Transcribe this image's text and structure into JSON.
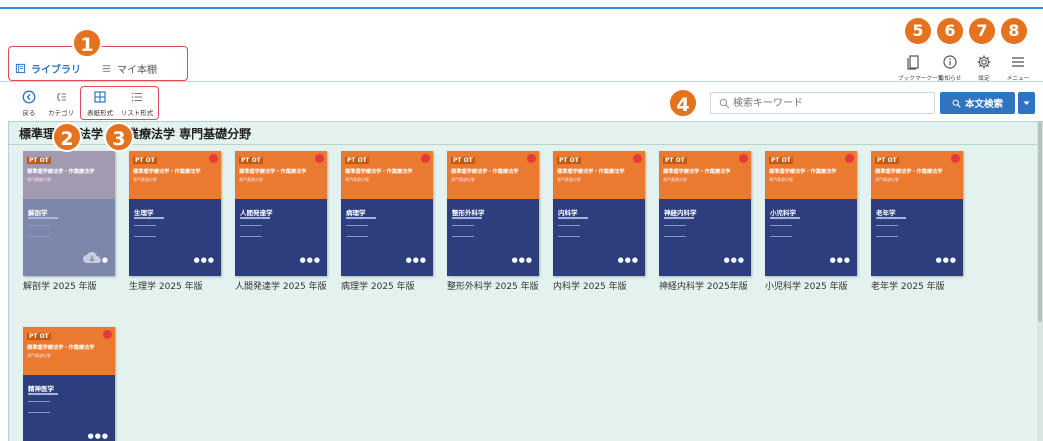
{
  "header": {
    "items": [
      {
        "num": "5",
        "label": "ブックマーク一覧",
        "icon": "bookmark-list-icon"
      },
      {
        "num": "6",
        "label": "お知らせ",
        "icon": "info-icon"
      },
      {
        "num": "7",
        "label": "設定",
        "icon": "gear-icon"
      },
      {
        "num": "8",
        "label": "メニュー",
        "icon": "menu-icon"
      }
    ]
  },
  "tabs": {
    "num": "1",
    "library": "ライブラリ",
    "my_shelf": "マイ本棚"
  },
  "toolbar": {
    "back": "戻る",
    "category": "カテゴリ",
    "cover_view": "表紙形式",
    "list_view": "リスト形式",
    "num_category": "2",
    "num_view": "3"
  },
  "search": {
    "num": "4",
    "placeholder": "検索キーワード",
    "button_label": "本文検索"
  },
  "section": {
    "title": "標準理学療法学・作業療法学 専門基礎分野"
  },
  "books": [
    {
      "subject": "解剖学",
      "title": "解剖学 2025 年版",
      "faded": true
    },
    {
      "subject": "生理学",
      "title": "生理学 2025 年版",
      "faded": false
    },
    {
      "subject": "人間発達学",
      "title": "人間発達学 2025 年版",
      "faded": false
    },
    {
      "subject": "病理学",
      "title": "病理学 2025 年版",
      "faded": false
    },
    {
      "subject": "整形外科学",
      "title": "整形外科学 2025 年版",
      "faded": false
    },
    {
      "subject": "内科学",
      "title": "内科学 2025 年版",
      "faded": false
    },
    {
      "subject": "神経内科学",
      "title": "神経内科学 2025年版",
      "faded": false
    },
    {
      "subject": "小児科学",
      "title": "小児科学 2025 年版",
      "faded": false
    },
    {
      "subject": "老年学",
      "title": "老年学 2025 年版",
      "faded": false
    },
    {
      "subject": "精神医学",
      "title": "",
      "faded": false
    }
  ],
  "cover_text": {
    "ptot": "PT OT",
    "series": "標準理学療法学・作業療法学",
    "series_sub": "専門基礎分野",
    "marks": "●●●"
  },
  "colors": {
    "accent": "#2f74c0",
    "callout": "#e5721f",
    "highlight_box": "#e14b59",
    "panel_bg": "#e3f2ee",
    "cover_blue": "#2c3e7d",
    "cover_orange": "#ea7a2f"
  }
}
